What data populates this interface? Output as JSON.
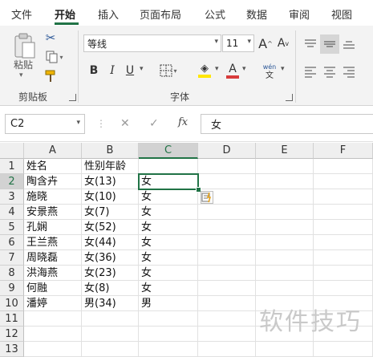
{
  "ribbon_tabs": [
    "文件",
    "开始",
    "插入",
    "页面布局",
    "公式",
    "数据",
    "审阅",
    "视图"
  ],
  "active_tab": "开始",
  "clipboard": {
    "paste_label": "粘贴",
    "group_label": "剪贴板"
  },
  "font": {
    "name": "等线",
    "size": "11",
    "group_label": "字体",
    "bold": "B",
    "italic": "I",
    "underline": "U",
    "grow": "A",
    "shrink": "A",
    "phonetic_top": "wén",
    "phonetic_bottom": "文",
    "font_color": "#d83b3b",
    "fill_color": "#ffe600"
  },
  "formula_bar": {
    "name_box": "C2",
    "fx": "fx",
    "cancel": "✕",
    "enter": "✓",
    "formula": "女"
  },
  "sheet": {
    "columns": [
      "A",
      "B",
      "C",
      "D",
      "E",
      "F"
    ],
    "selected_column": "C",
    "selected_row": "2",
    "row_numbers": [
      "1",
      "2",
      "3",
      "4",
      "5",
      "6",
      "7",
      "8",
      "9",
      "10",
      "11",
      "12",
      "13"
    ],
    "rows": [
      [
        "姓名",
        "性别年龄",
        ""
      ],
      [
        "陶含卉",
        "女(13)",
        "女"
      ],
      [
        "施晓",
        "女(10)",
        "女"
      ],
      [
        "安景燕",
        "女(7)",
        "女"
      ],
      [
        "孔娴",
        "女(52)",
        "女"
      ],
      [
        "王兰燕",
        "女(44)",
        "女"
      ],
      [
        "周晓磊",
        "女(36)",
        "女"
      ],
      [
        "洪海燕",
        "女(23)",
        "女"
      ],
      [
        "何融",
        "女(8)",
        "女"
      ],
      [
        "潘婷",
        "男(34)",
        "男"
      ],
      [
        "",
        "",
        ""
      ],
      [
        "",
        "",
        ""
      ],
      [
        "",
        "",
        ""
      ]
    ]
  },
  "watermark": "软件技巧"
}
